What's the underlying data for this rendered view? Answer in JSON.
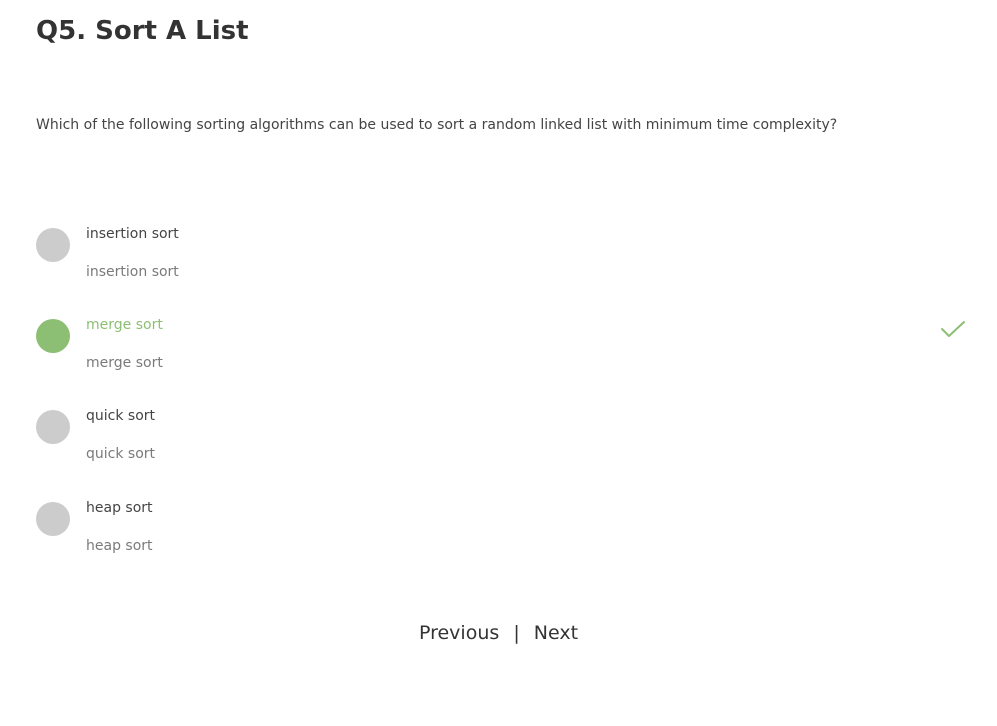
{
  "quiz": {
    "title": "Q5. Sort A List",
    "question": "Which of the following sorting algorithms can be used to sort a random linked list with minimum time complexity?",
    "options": [
      {
        "label": "insertion sort",
        "sublabel": "insertion sort",
        "selected": false
      },
      {
        "label": "merge sort",
        "sublabel": "merge sort",
        "selected": true
      },
      {
        "label": "quick sort",
        "sublabel": "quick sort",
        "selected": false
      },
      {
        "label": "heap sort",
        "sublabel": "heap sort",
        "selected": false
      }
    ],
    "correct_icon": "check-icon"
  },
  "nav": {
    "previous_label": "Previous",
    "separator": "|",
    "next_label": "Next"
  },
  "colors": {
    "accent": "#8cbf73",
    "radio_unselected": "#cccccc",
    "text": "#333333",
    "subtext": "#7a7a7a"
  }
}
